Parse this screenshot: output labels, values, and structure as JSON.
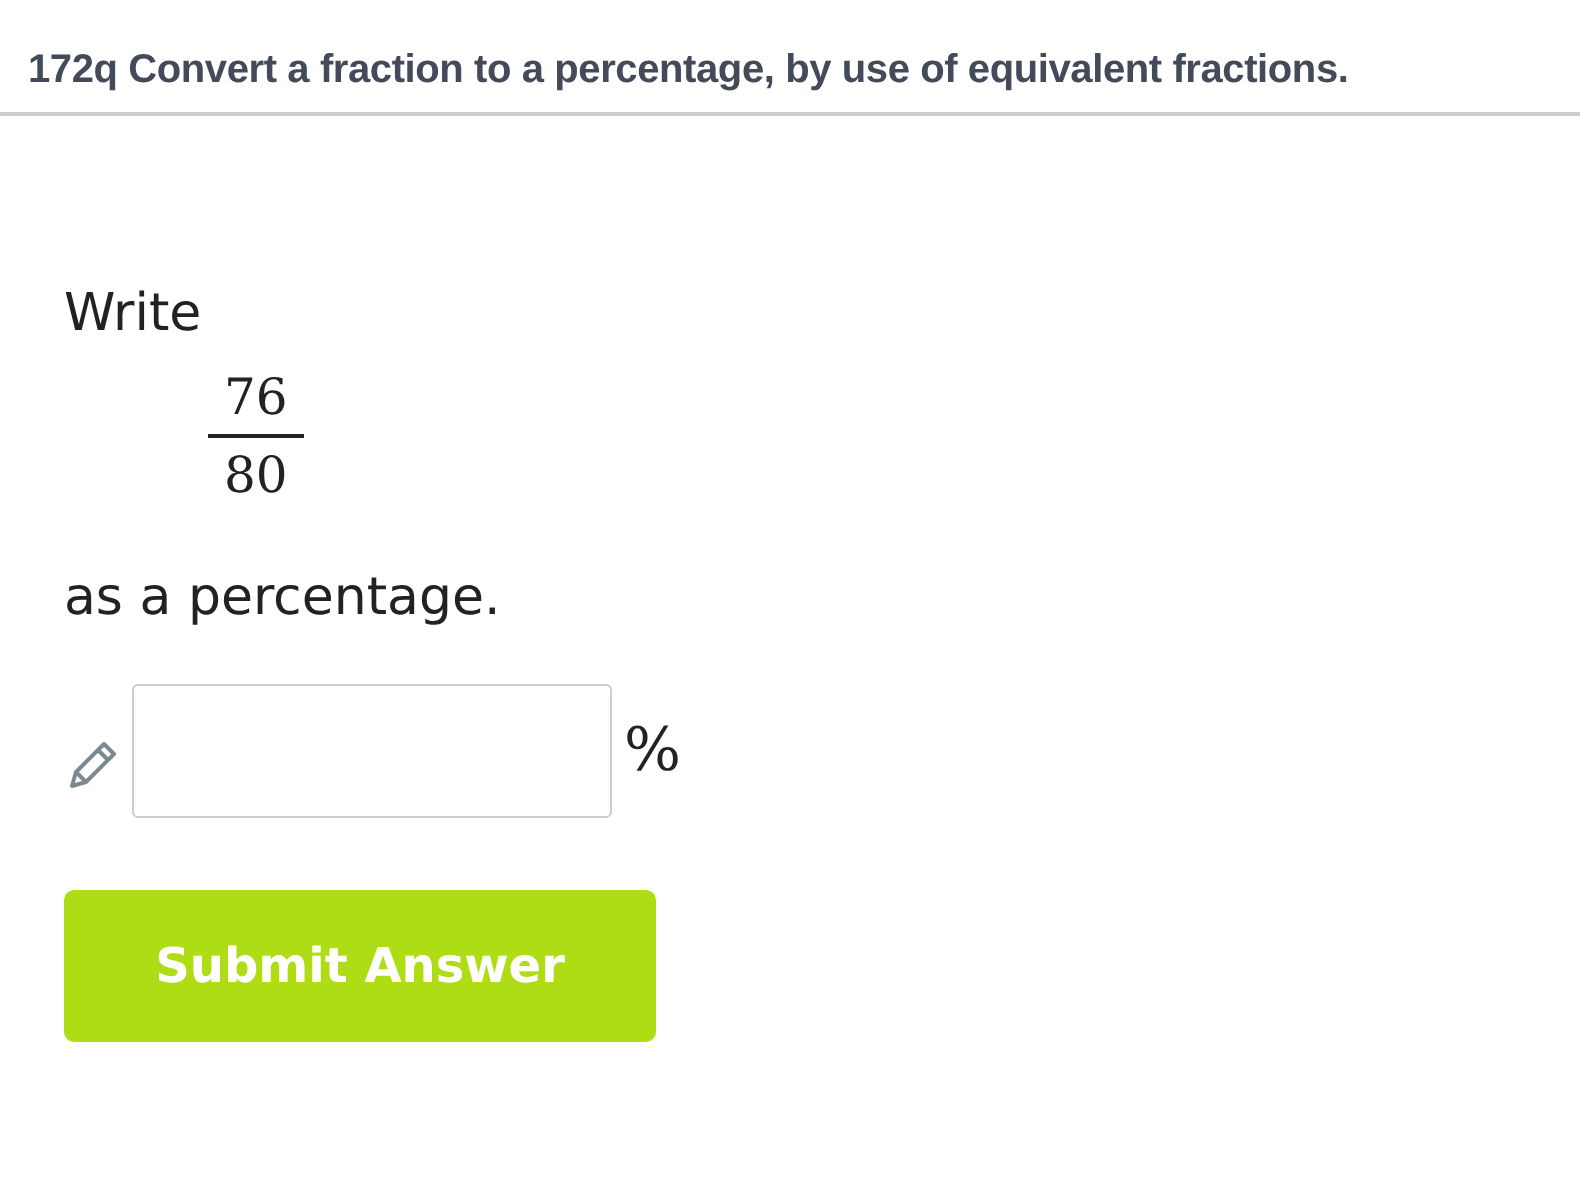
{
  "title": "172q Convert a fraction to a percentage, by use of equivalent fractions.",
  "prompt_before": "Write",
  "fraction": {
    "numerator": "76",
    "denominator": "80"
  },
  "prompt_after": "as a percentage.",
  "answer": {
    "unit": "%"
  },
  "submit_button": "Submit Answer"
}
